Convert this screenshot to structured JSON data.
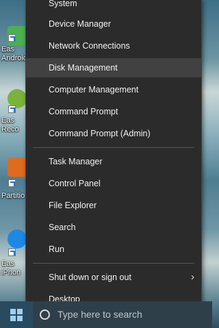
{
  "desktop": {
    "icons": [
      {
        "line1": "Eas",
        "line2": "Android",
        "color": "#4caf50"
      },
      {
        "line1": "Eas",
        "line2": "Reco",
        "color": "#7bb33a"
      },
      {
        "line1": "Partitio",
        "line2": "",
        "color": "#e06b1f"
      },
      {
        "line1": "Eas",
        "line2": "iPhon",
        "color": "#1e88e5"
      }
    ]
  },
  "menu": {
    "items": [
      {
        "label": "System"
      },
      {
        "label": "Device Manager"
      },
      {
        "label": "Network Connections"
      },
      {
        "label": "Disk Management"
      },
      {
        "label": "Computer Management"
      },
      {
        "label": "Command Prompt"
      },
      {
        "label": "Command Prompt (Admin)"
      },
      {
        "label": "Task Manager"
      },
      {
        "label": "Control Panel"
      },
      {
        "label": "File Explorer"
      },
      {
        "label": "Search"
      },
      {
        "label": "Run"
      },
      {
        "label": "Shut down or sign out"
      },
      {
        "label": "Desktop"
      }
    ],
    "highlighted": "Disk Management",
    "submenu_indicator": "›"
  },
  "taskbar": {
    "search_placeholder": "Type here to search"
  }
}
